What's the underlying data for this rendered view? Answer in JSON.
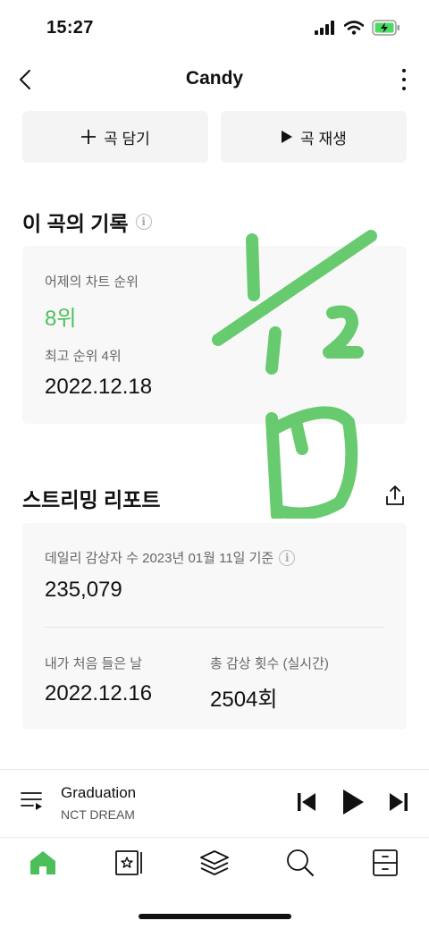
{
  "status": {
    "time": "15:27"
  },
  "header": {
    "title": "Candy"
  },
  "actions": {
    "add_label": "곡 담기",
    "play_label": "곡 재생"
  },
  "record": {
    "title": "이 곡의 기록",
    "yesterday_label": "어제의 차트 순위",
    "yesterday_rank": "8위",
    "best_label": "최고 순위 4위",
    "best_date": "2022.12.18"
  },
  "report": {
    "title": "스트리밍 리포트",
    "daily_label": "데일리 감상자 수 2023년 01월 11일 기준",
    "daily_value": "235,079",
    "first_label": "내가 처음 들은 날",
    "first_value": "2022.12.16",
    "total_label": "총 감상 횟수 (실시간)",
    "total_value": "2504회"
  },
  "player": {
    "title": "Graduation",
    "artist": "NCT DREAM"
  },
  "colors": {
    "accent": "#4cbf5a",
    "scribble": "#5cc763"
  }
}
